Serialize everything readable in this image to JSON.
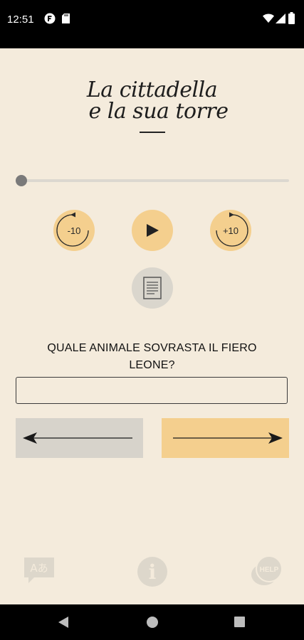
{
  "status_bar": {
    "time": "12:51",
    "icons": [
      "notification-f-icon",
      "sd-card-icon",
      "wifi-icon",
      "signal-icon",
      "battery-icon"
    ]
  },
  "title": {
    "line1": "La cittadella",
    "line2": "e la sua torre"
  },
  "player": {
    "progress": 0,
    "rewind_label": "-10",
    "forward_label": "+10",
    "play_icon": "play-icon",
    "transcript_icon": "document-icon"
  },
  "question": {
    "text": "QUALE ANIMALE SOVRASTA IL FIERO LEONE?"
  },
  "answer": {
    "value": "",
    "placeholder": ""
  },
  "navigation": {
    "prev_icon": "arrow-left-icon",
    "next_icon": "arrow-right-icon"
  },
  "bottom_bar": {
    "translate_icon": "translate-icon",
    "translate_glyphs": "Aあ",
    "info_glyph": "i",
    "help_label": "HELP"
  },
  "colors": {
    "background": "#f4ebdc",
    "accent": "#f4cf8e",
    "gray_button": "#d7d3cb",
    "faded_icon": "#ddd7cb"
  },
  "system_nav": [
    "back-icon",
    "home-icon",
    "recents-icon"
  ]
}
